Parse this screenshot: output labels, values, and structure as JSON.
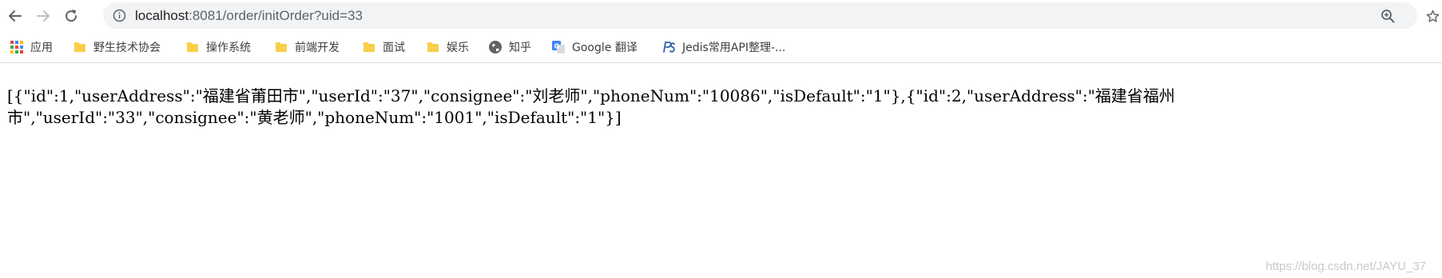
{
  "address_bar": {
    "url_host": "localhost",
    "url_rest": ":8081/order/initOrder?uid=33"
  },
  "toolbar": {
    "back_icon": "arrow-left-icon",
    "forward_icon": "arrow-right-icon",
    "reload_icon": "reload-icon",
    "zoom_icon": "zoom-in-icon",
    "bookmark_star_icon": "star-icon"
  },
  "bookmarks": {
    "items": [
      {
        "label": "应用",
        "icon": "apps-grid-icon"
      },
      {
        "label": "野生技术协会",
        "icon": "folder-icon"
      },
      {
        "label": "操作系统",
        "icon": "folder-icon"
      },
      {
        "label": "前端开发",
        "icon": "folder-icon"
      },
      {
        "label": "面试",
        "icon": "folder-icon"
      },
      {
        "label": "娱乐",
        "icon": "folder-icon"
      },
      {
        "label": "知乎",
        "icon": "globe-icon"
      },
      {
        "label": "Google 翻译",
        "icon": "google-translate-icon"
      },
      {
        "label": "Jedis常用API整理-...",
        "icon": "ps-icon"
      }
    ]
  },
  "page": {
    "json_line_1": "[{\"id\":1,\"userAddress\":\"福建省莆田市\",\"userId\":\"37\",\"consignee\":\"刘老师\",\"phoneNum\":\"10086\",\"isDefault\":\"1\"},{\"id\":2,\"userAddress\":\"福建省福州",
    "json_line_2": "市\",\"userId\":\"33\",\"consignee\":\"黄老师\",\"phoneNum\":\"1001\",\"isDefault\":\"1\"}]"
  },
  "watermark": "https://blog.csdn.net/JAYU_37",
  "colors": {
    "omnibox_bg": "#f1f3f4",
    "folder": "#f9cf4a",
    "apps_red": "#ea4335",
    "apps_blue": "#4285f4",
    "apps_yellow": "#fbbc05",
    "apps_green": "#34a853"
  }
}
